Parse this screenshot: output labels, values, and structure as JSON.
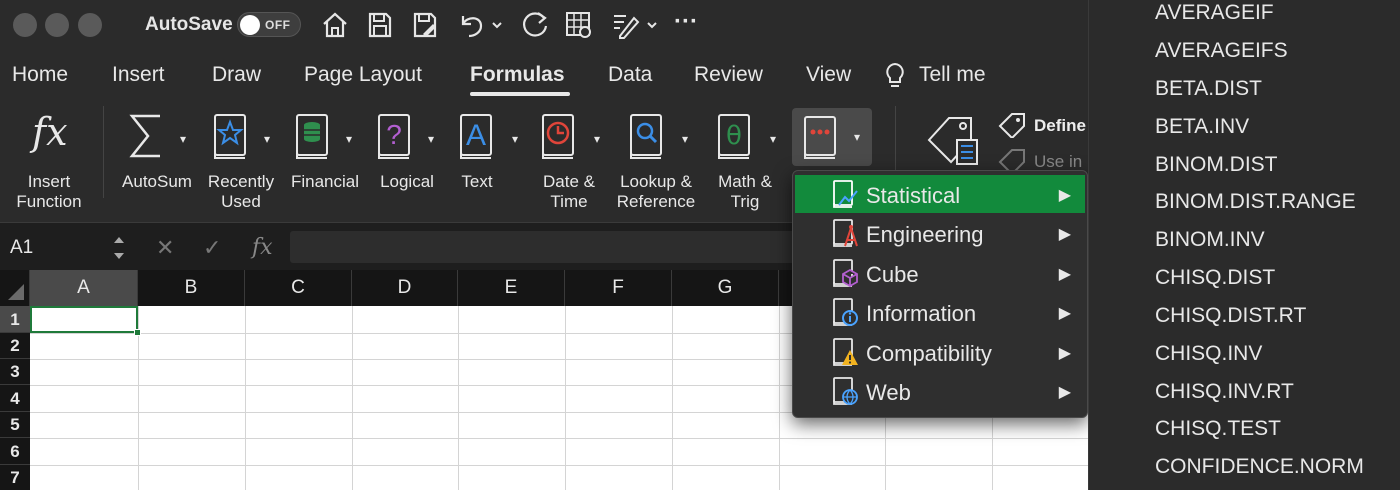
{
  "titlebar": {
    "autosave_label": "AutoSave",
    "autosave_state": "OFF",
    "quick_access": [
      "home-icon",
      "save-icon",
      "save-as-icon",
      "undo-icon",
      "redo-icon",
      "sheet-icon",
      "edit-icon",
      "more-icon"
    ],
    "more_label": "···"
  },
  "tabs": [
    {
      "label": "Home"
    },
    {
      "label": "Insert"
    },
    {
      "label": "Draw"
    },
    {
      "label": "Page Layout"
    },
    {
      "label": "Formulas",
      "active": true
    },
    {
      "label": "Data"
    },
    {
      "label": "Review"
    },
    {
      "label": "View"
    },
    {
      "label": "Tell me"
    }
  ],
  "ribbon": {
    "insert_function": {
      "line1": "Insert",
      "line2": "Function",
      "icon_text": "fx"
    },
    "buttons": [
      {
        "line1": "AutoSum",
        "line2": ""
      },
      {
        "line1": "Recently",
        "line2": "Used"
      },
      {
        "line1": "Financial",
        "line2": ""
      },
      {
        "line1": "Logical",
        "line2": ""
      },
      {
        "line1": "Text",
        "line2": ""
      },
      {
        "line1": "Date &",
        "line2": "Time"
      },
      {
        "line1": "Lookup &",
        "line2": "Reference"
      },
      {
        "line1": "Math &",
        "line2": "Trig"
      }
    ],
    "glyphs": {
      "logical": "?",
      "text": "A",
      "math": "θ"
    },
    "define_name": "Define",
    "use_in": "Use in"
  },
  "formula_bar": {
    "name_box": "A1",
    "cancel_glyph": "✕",
    "enter_glyph": "✓",
    "fx_label": "fx",
    "formula": ""
  },
  "grid": {
    "columns": [
      "A",
      "B",
      "C",
      "D",
      "E",
      "F",
      "G"
    ],
    "rows": [
      "1",
      "2",
      "3",
      "4",
      "5",
      "6",
      "7"
    ],
    "active_cell": "A1"
  },
  "more_functions_menu": {
    "items": [
      {
        "label": "Statistical",
        "icon": "statistical-icon",
        "highlighted": true
      },
      {
        "label": "Engineering",
        "icon": "engineering-icon"
      },
      {
        "label": "Cube",
        "icon": "cube-icon"
      },
      {
        "label": "Information",
        "icon": "information-icon"
      },
      {
        "label": "Compatibility",
        "icon": "compatibility-icon"
      },
      {
        "label": "Web",
        "icon": "web-icon"
      }
    ],
    "arrow_glyph": "▶",
    "highlight_color": "#128a3c"
  },
  "statistical_submenu": [
    "AVERAGEIF",
    "AVERAGEIFS",
    "BETA.DIST",
    "BETA.INV",
    "BINOM.DIST",
    "BINOM.DIST.RANGE",
    "BINOM.INV",
    "CHISQ.DIST",
    "CHISQ.DIST.RT",
    "CHISQ.INV",
    "CHISQ.INV.RT",
    "CHISQ.TEST",
    "CONFIDENCE.NORM"
  ]
}
